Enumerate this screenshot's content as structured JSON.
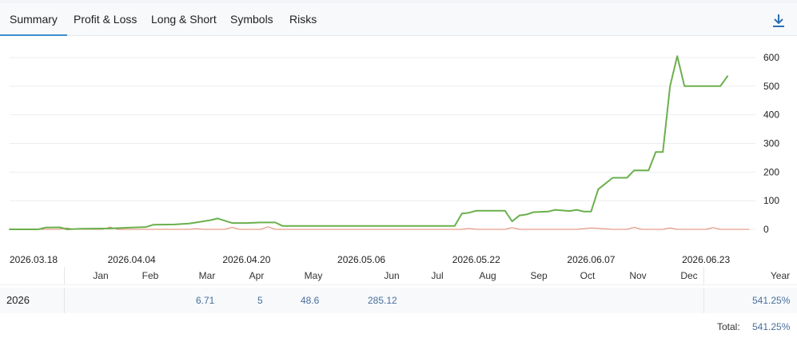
{
  "tabs": [
    {
      "label": "Summary",
      "active": true
    },
    {
      "label": "Profit & Loss",
      "active": false
    },
    {
      "label": "Long & Short",
      "active": false
    },
    {
      "label": "Symbols",
      "active": false
    },
    {
      "label": "Risks",
      "active": false
    }
  ],
  "download_icon": "download-icon",
  "colors": {
    "growth": "#6ab04c",
    "secondary": "#e0866b",
    "accent": "#3e8fd0",
    "value": "#4a6f9c"
  },
  "chart_data": {
    "type": "line",
    "title": "",
    "xlabel": "",
    "ylabel": "",
    "ylim": [
      0,
      600
    ],
    "yticks": [
      0,
      100,
      200,
      300,
      400,
      500,
      600
    ],
    "xtick_labels": [
      "2026.03.18",
      "2026.04.04",
      "2026.04.20",
      "2026.05.06",
      "2026.05.22",
      "2026.06.07",
      "2026.06.23"
    ],
    "x_range": [
      "2026.03.18",
      "2026.06.29"
    ],
    "grid": true,
    "series": [
      {
        "color": "#6ab04c",
        "points": [
          [
            "2026.03.18",
            0
          ],
          [
            "2026.03.22",
            0
          ],
          [
            "2026.03.23",
            6
          ],
          [
            "2026.03.25",
            7
          ],
          [
            "2026.03.26",
            0
          ],
          [
            "2026.03.28",
            2
          ],
          [
            "2026.04.01",
            3
          ],
          [
            "2026.04.04",
            6
          ],
          [
            "2026.04.06",
            8
          ],
          [
            "2026.04.07",
            16
          ],
          [
            "2026.04.10",
            17
          ],
          [
            "2026.04.12",
            20
          ],
          [
            "2026.04.13",
            24
          ],
          [
            "2026.04.15",
            32
          ],
          [
            "2026.04.16",
            38
          ],
          [
            "2026.04.17",
            30
          ],
          [
            "2026.04.18",
            22
          ],
          [
            "2026.04.20",
            22
          ],
          [
            "2026.04.22",
            24
          ],
          [
            "2026.04.24",
            24
          ],
          [
            "2026.04.25",
            12
          ],
          [
            "2026.05.18",
            12
          ],
          [
            "2026.05.19",
            12
          ],
          [
            "2026.05.20",
            55
          ],
          [
            "2026.05.21",
            58
          ],
          [
            "2026.05.22",
            65
          ],
          [
            "2026.05.26",
            65
          ],
          [
            "2026.05.27",
            28
          ],
          [
            "2026.05.28",
            48
          ],
          [
            "2026.05.29",
            52
          ],
          [
            "2026.05.30",
            60
          ],
          [
            "2026.06.01",
            62
          ],
          [
            "2026.06.02",
            68
          ],
          [
            "2026.06.04",
            64
          ],
          [
            "2026.06.05",
            68
          ],
          [
            "2026.06.06",
            62
          ],
          [
            "2026.06.07",
            62
          ],
          [
            "2026.06.08",
            140
          ],
          [
            "2026.06.09",
            160
          ],
          [
            "2026.06.10",
            180
          ],
          [
            "2026.06.12",
            180
          ],
          [
            "2026.06.13",
            206
          ],
          [
            "2026.06.15",
            206
          ],
          [
            "2026.06.16",
            270
          ],
          [
            "2026.06.17",
            270
          ],
          [
            "2026.06.18",
            500
          ],
          [
            "2026.06.19",
            605
          ],
          [
            "2026.06.20",
            500
          ],
          [
            "2026.06.23",
            500
          ],
          [
            "2026.06.24",
            500
          ],
          [
            "2026.06.25",
            500
          ],
          [
            "2026.06.26",
            535
          ]
        ]
      },
      {
        "color": "#e0866b",
        "points": [
          [
            "2026.03.18",
            0
          ],
          [
            "2026.03.25",
            0
          ],
          [
            "2026.03.26",
            5
          ],
          [
            "2026.03.27",
            0
          ],
          [
            "2026.03.31",
            0
          ],
          [
            "2026.04.01",
            8
          ],
          [
            "2026.04.02",
            0
          ],
          [
            "2026.04.12",
            0
          ],
          [
            "2026.04.13",
            2
          ],
          [
            "2026.04.14",
            0
          ],
          [
            "2026.04.17",
            0
          ],
          [
            "2026.04.18",
            7
          ],
          [
            "2026.04.19",
            0
          ],
          [
            "2026.04.22",
            0
          ],
          [
            "2026.04.23",
            9
          ],
          [
            "2026.04.24",
            0
          ],
          [
            "2026.05.20",
            0
          ],
          [
            "2026.05.21",
            3
          ],
          [
            "2026.05.22",
            0
          ],
          [
            "2026.05.26",
            0
          ],
          [
            "2026.05.27",
            6
          ],
          [
            "2026.05.28",
            0
          ],
          [
            "2026.06.05",
            0
          ],
          [
            "2026.06.07",
            5
          ],
          [
            "2026.06.10",
            0
          ],
          [
            "2026.06.12",
            0
          ],
          [
            "2026.06.13",
            7
          ],
          [
            "2026.06.14",
            0
          ],
          [
            "2026.06.17",
            0
          ],
          [
            "2026.06.18",
            5
          ],
          [
            "2026.06.19",
            0
          ],
          [
            "2026.06.23",
            0
          ],
          [
            "2026.06.24",
            6
          ],
          [
            "2026.06.25",
            0
          ],
          [
            "2026.06.29",
            0
          ]
        ]
      }
    ]
  },
  "returns_table": {
    "months": [
      "Jan",
      "Feb",
      "Mar",
      "Apr",
      "May",
      "Jun",
      "Jul",
      "Aug",
      "Sep",
      "Oct",
      "Nov",
      "Dec"
    ],
    "year_header": "Year",
    "rows": [
      {
        "year": "2026",
        "values": [
          "",
          "",
          "6.71",
          "5",
          "48.6",
          "285.12",
          "",
          "",
          "",
          "",
          "",
          ""
        ],
        "total": "541.25%"
      }
    ],
    "total_label": "Total:",
    "total_value": "541.25%"
  }
}
